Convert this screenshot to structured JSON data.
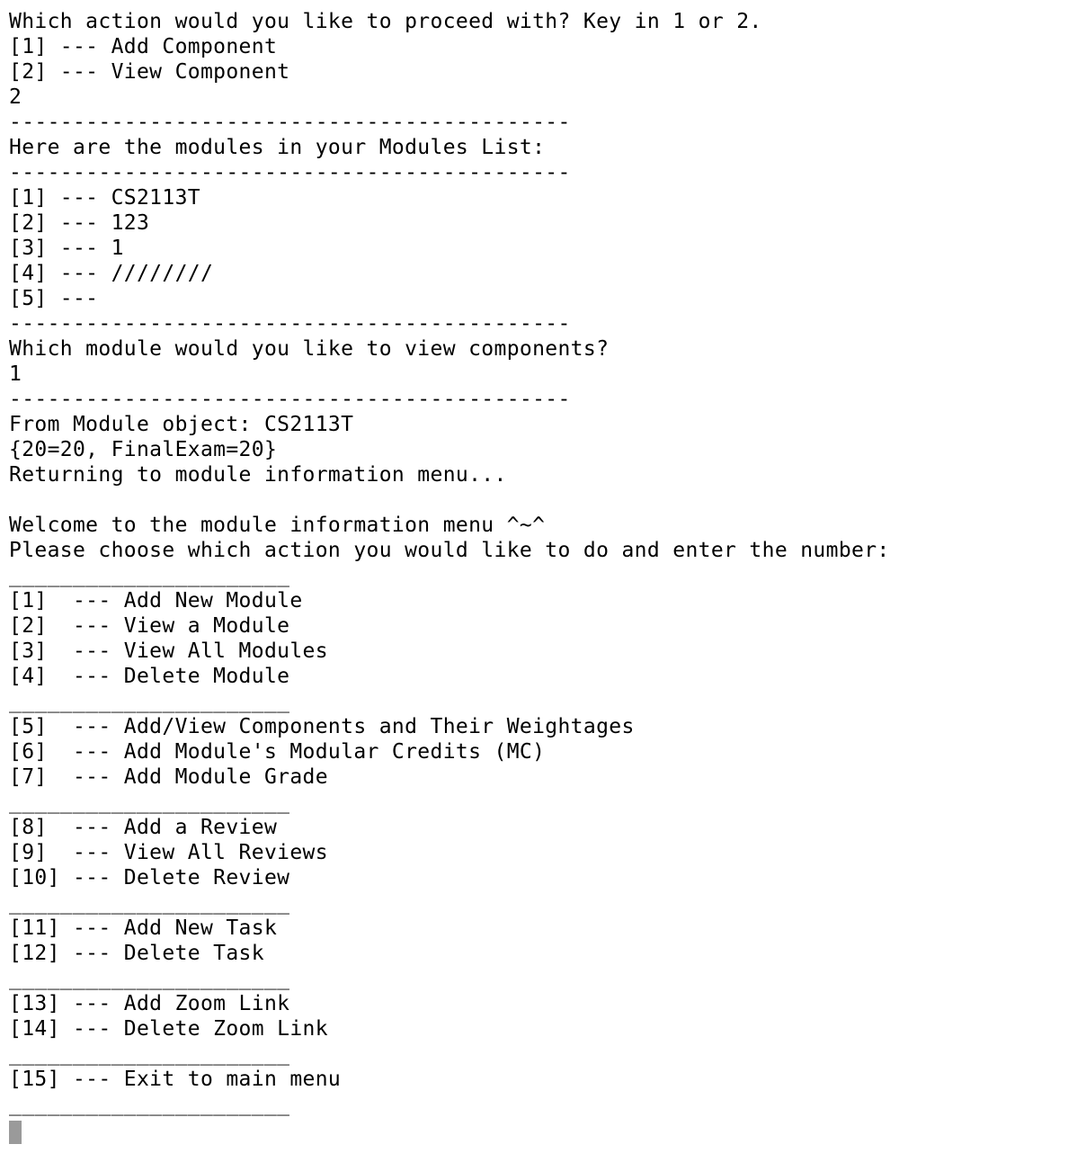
{
  "terminal": {
    "lines": [
      "Which action would you like to proceed with? Key in 1 or 2.",
      "[1] --- Add Component",
      "[2] --- View Component",
      "2",
      "--------------------------------------------",
      "Here are the modules in your Modules List:",
      "--------------------------------------------",
      "[1] --- CS2113T",
      "[2] --- 123",
      "[3] --- 1",
      "[4] --- ////////",
      "[5] ---",
      "--------------------------------------------",
      "Which module would you like to view components?",
      "1",
      "--------------------------------------------",
      "From Module object: CS2113T",
      "{20=20, FinalExam=20}",
      "Returning to module information menu...",
      "",
      "Welcome to the module information menu ^~^",
      "Please choose which action you would like to do and enter the number:",
      "______________________",
      "[1]  --- Add New Module",
      "[2]  --- View a Module",
      "[3]  --- View All Modules",
      "[4]  --- Delete Module",
      "______________________",
      "[5]  --- Add/View Components and Their Weightages",
      "[6]  --- Add Module's Modular Credits (MC)",
      "[7]  --- Add Module Grade",
      "______________________",
      "[8]  --- Add a Review",
      "[9]  --- View All Reviews",
      "[10] --- Delete Review",
      "______________________",
      "[11] --- Add New Task",
      "[12] --- Delete Task",
      "______________________",
      "[13] --- Add Zoom Link",
      "[14] --- Delete Zoom Link",
      "______________________",
      "[15] --- Exit to main menu",
      "______________________"
    ]
  },
  "colors": {
    "background": "#ffffff",
    "text": "#000000",
    "cursor": "#9a9a9a"
  }
}
